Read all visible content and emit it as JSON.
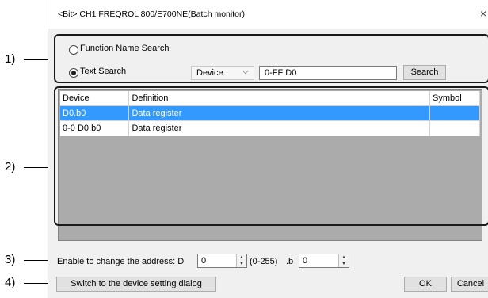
{
  "callouts": [
    "1)",
    "2)",
    "3)",
    "4)"
  ],
  "dialog": {
    "title": "<Bit> CH1 FREQROL 800/E700NE(Batch monitor)",
    "close_glyph": "×"
  },
  "search": {
    "function_name_label": "Function Name Search",
    "text_search_label": "Text Search",
    "selected_mode": "Text Search",
    "device_select_value": "Device",
    "select_chevron": "⌵",
    "text_value": "0-FF D0",
    "search_button": "Search"
  },
  "table": {
    "headers": [
      "Device",
      "Definition",
      "Symbol"
    ],
    "rows": [
      {
        "device": "D0.b0",
        "definition": "Data register",
        "symbol": "",
        "selected": true
      },
      {
        "device": "0-0 D0.b0",
        "definition": "Data register",
        "symbol": "",
        "selected": false
      }
    ]
  },
  "address": {
    "label": "Enable to change the address: D",
    "d_value": "0",
    "range_text": "(0-255)",
    "b_label": ".b",
    "b_value": "0"
  },
  "footer": {
    "switch_button": "Switch to the device setting dialog",
    "ok_button": "OK",
    "cancel_button": "Cancel"
  }
}
